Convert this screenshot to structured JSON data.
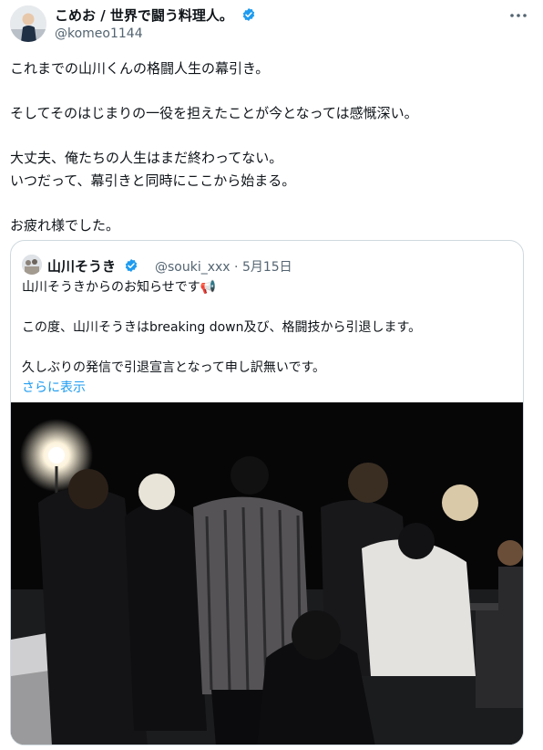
{
  "author": {
    "name": "こめお / 世界で闘う料理人。",
    "handle": "@komeo1144"
  },
  "tweet_text": {
    "line1": "これまでの山川くんの格闘人生の幕引き。",
    "line2": "そしてそのはじまりの一役を担えたことが今となっては感慨深い。",
    "line3": "大丈夫、俺たちの人生はまだ終わってない。",
    "line4": "いつだって、幕引きと同時にここから始まる。",
    "line5": "お疲れ様でした。"
  },
  "quoted": {
    "name": "山川そうき",
    "handle": "@souki_xxx",
    "separator": "·",
    "date": "5月15日",
    "line1": "山川そうきからのお知らせです📢",
    "line2": "この度、山川そうきはbreaking down及び、格闘技から引退します。",
    "line3": "久しぶりの発信で引退宣言となって申し訳無いです。",
    "show_more": "さらに表示"
  },
  "colors": {
    "verified_badge": "#1d9bf0",
    "link": "#1d9bf0",
    "secondary_text": "#536471",
    "media_background": "#060607"
  }
}
